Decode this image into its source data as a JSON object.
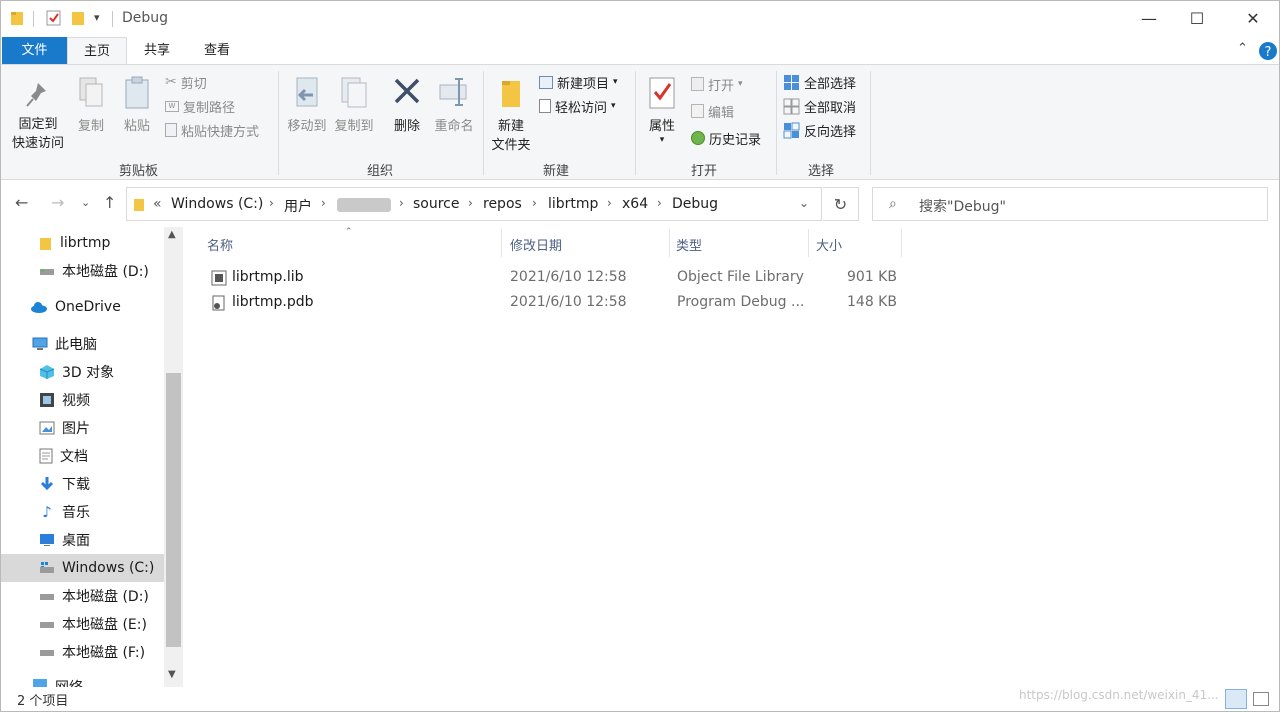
{
  "window": {
    "title": "Debug",
    "controls": {
      "minimize": "—",
      "maximize": "☐",
      "close": "✕"
    }
  },
  "ribbon": {
    "tabs": [
      "文件",
      "主页",
      "共享",
      "查看"
    ],
    "groups": {
      "clipboard": {
        "label": "剪贴板",
        "pin_line1": "固定到",
        "pin_line2": "快速访问",
        "copy": "复制",
        "paste": "粘贴",
        "cut": "剪切",
        "copy_path": "复制路径",
        "paste_shortcut": "粘贴快捷方式"
      },
      "organize": {
        "label": "组织",
        "move_to": "移动到",
        "copy_to": "复制到",
        "delete": "删除",
        "rename": "重命名"
      },
      "new": {
        "label": "新建",
        "new_folder_line1": "新建",
        "new_folder_line2": "文件夹",
        "new_item": "新建项目",
        "easy_access": "轻松访问"
      },
      "open": {
        "label": "打开",
        "properties": "属性",
        "open": "打开",
        "edit": "编辑",
        "history": "历史记录"
      },
      "select": {
        "label": "选择",
        "select_all": "全部选择",
        "select_none": "全部取消",
        "invert": "反向选择"
      }
    }
  },
  "address": {
    "overflow": "«",
    "crumbs": [
      "Windows (C:)",
      "用户",
      "source",
      "repos",
      "librtmp",
      "x64",
      "Debug"
    ],
    "search_placeholder": "搜索\"Debug\""
  },
  "nav": {
    "items": [
      {
        "label": "librtmp",
        "icon": "folder-icon"
      },
      {
        "label": "本地磁盘 (D:)",
        "icon": "drive-icon"
      },
      {
        "label": "OneDrive",
        "icon": "cloud-icon"
      },
      {
        "label": "此电脑",
        "icon": "computer-icon"
      },
      {
        "label": "3D 对象",
        "icon": "cube-icon"
      },
      {
        "label": "视频",
        "icon": "video-icon"
      },
      {
        "label": "图片",
        "icon": "picture-icon"
      },
      {
        "label": "文档",
        "icon": "document-icon"
      },
      {
        "label": "下载",
        "icon": "download-icon"
      },
      {
        "label": "音乐",
        "icon": "music-icon"
      },
      {
        "label": "桌面",
        "icon": "desktop-icon"
      },
      {
        "label": "Windows (C:)",
        "icon": "windows-drive-icon"
      },
      {
        "label": "本地磁盘 (D:)",
        "icon": "drive-icon"
      },
      {
        "label": "本地磁盘 (E:)",
        "icon": "drive-icon"
      },
      {
        "label": "本地磁盘 (F:)",
        "icon": "drive-icon"
      },
      {
        "label": "网络",
        "icon": "network-icon"
      }
    ],
    "selected": "Windows (C:)"
  },
  "columns": [
    "名称",
    "修改日期",
    "类型",
    "大小"
  ],
  "files": [
    {
      "name": "librtmp.lib",
      "date": "2021/6/10 12:58",
      "type": "Object File Library",
      "size": "901 KB"
    },
    {
      "name": "librtmp.pdb",
      "date": "2021/6/10 12:58",
      "type": "Program Debug ...",
      "size": "148 KB"
    }
  ],
  "status": {
    "count": "2 个项目"
  },
  "watermark": "https://blog.csdn.net/weixin_41..."
}
